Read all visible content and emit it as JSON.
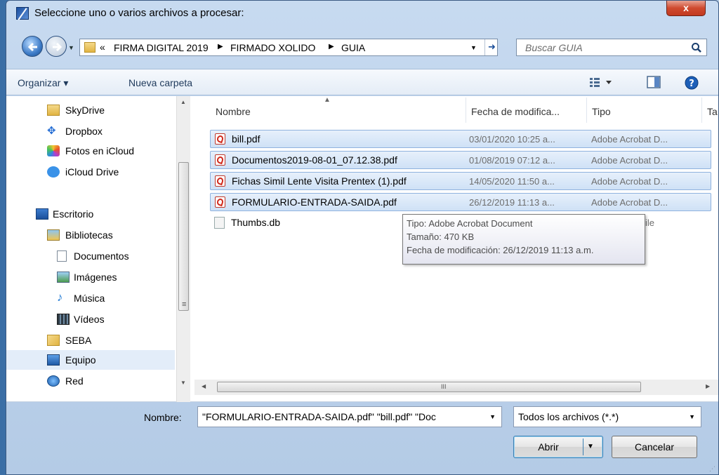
{
  "window": {
    "title": "Seleccione uno o varios archivos a procesar:",
    "close_label": "x"
  },
  "address": {
    "overflow": "«",
    "crumbs": [
      "FIRMA DIGITAL 2019",
      "FIRMADO XOLIDO",
      "GUIA"
    ],
    "separator": "▶"
  },
  "search": {
    "placeholder": "Buscar GUIA"
  },
  "toolbar": {
    "organize": "Organizar ▾",
    "new_folder": "Nueva carpeta"
  },
  "sidebar": {
    "items": [
      {
        "label": "SkyDrive",
        "icon": "folder-icon"
      },
      {
        "label": "Dropbox",
        "icon": "dropbox-icon"
      },
      {
        "label": "Fotos en iCloud",
        "icon": "photos-icon"
      },
      {
        "label": "iCloud Drive",
        "icon": "cloud-icon"
      },
      {
        "label": "Escritorio",
        "icon": "desktop-icon"
      },
      {
        "label": "Bibliotecas",
        "icon": "library-icon"
      },
      {
        "label": "Documentos",
        "icon": "document-icon"
      },
      {
        "label": "Imágenes",
        "icon": "image-icon"
      },
      {
        "label": "Música",
        "icon": "music-icon"
      },
      {
        "label": "Vídeos",
        "icon": "video-icon"
      },
      {
        "label": "SEBA",
        "icon": "user-folder-icon"
      },
      {
        "label": "Equipo",
        "icon": "computer-icon"
      },
      {
        "label": "Red",
        "icon": "network-icon"
      }
    ]
  },
  "columns": {
    "name": "Nombre",
    "date": "Fecha de modifica...",
    "type": "Tipo",
    "size": "Ta"
  },
  "files": [
    {
      "name": "bill.pdf",
      "date": "03/01/2020 10:25 a...",
      "type": "Adobe Acrobat D...",
      "selected": true
    },
    {
      "name": "Documentos2019-08-01_07.12.38.pdf",
      "date": "01/08/2019 07:12 a...",
      "type": "Adobe Acrobat D...",
      "selected": true
    },
    {
      "name": "Fichas Simil Lente Visita Prentex (1).pdf",
      "date": "14/05/2020 11:50 a...",
      "type": "Adobe Acrobat D...",
      "selected": true
    },
    {
      "name": "FORMULARIO-ENTRADA-SAIDA.pdf",
      "date": "26/12/2019 11:13 a...",
      "type": "Adobe Acrobat D...",
      "selected": true
    },
    {
      "name": "Thumbs.db",
      "date": "",
      "type": "ile",
      "selected": false
    }
  ],
  "tooltip": {
    "type": "Tipo: Adobe Acrobat Document",
    "size": "Tamaño: 470 KB",
    "modified": "Fecha de modificación: 26/12/2019 11:13 a.m."
  },
  "filename": {
    "label": "Nombre:",
    "value": "\"FORMULARIO-ENTRADA-SAIDA.pdf\" \"bill.pdf\" \"Doc"
  },
  "filter": {
    "selected": "Todos los archivos  (*.*)"
  },
  "buttons": {
    "open": "Abrir",
    "cancel": "Cancelar"
  },
  "hscroll": {
    "grip": "III"
  }
}
